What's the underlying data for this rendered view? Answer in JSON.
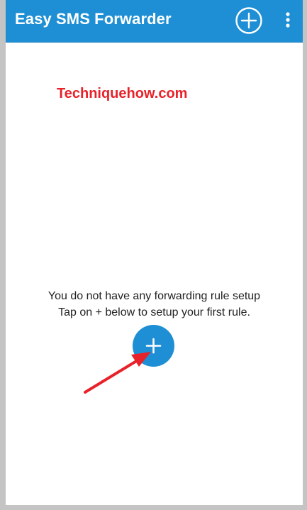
{
  "app": {
    "title": "Easy SMS Forwarder"
  },
  "toolbar": {
    "add_icon": "plus-circle-icon",
    "menu_icon": "more-vertical-icon"
  },
  "watermark": {
    "text": "Techniquehow.com"
  },
  "empty_state": {
    "line1": "You do not have any forwarding rule setup",
    "line2": "Tap on + below to setup your first rule."
  },
  "fab": {
    "icon": "plus-icon"
  },
  "colors": {
    "accent": "#1e8fd4",
    "watermark": "#e8222a",
    "annotation_arrow": "#e8222a"
  }
}
